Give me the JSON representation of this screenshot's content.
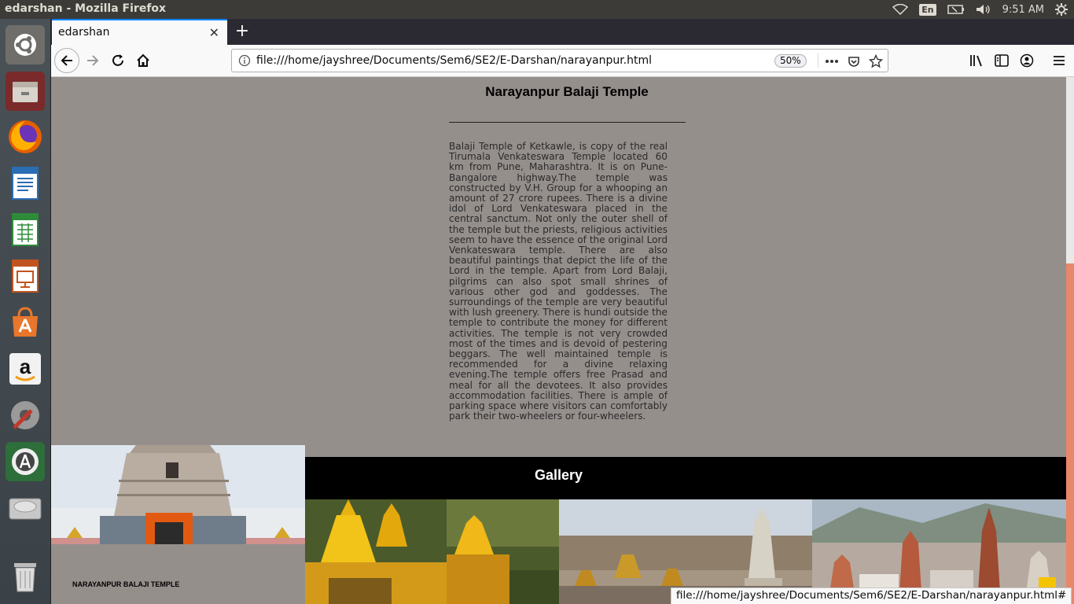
{
  "system": {
    "window_title": "edarshan - Mozilla Firefox",
    "input_lang": "En",
    "clock": "9:51 AM"
  },
  "launcher": {
    "items": [
      "ubuntu-dash-icon",
      "files-icon",
      "firefox-icon",
      "writer-icon",
      "calc-icon",
      "impress-icon",
      "software-center-icon",
      "amazon-icon",
      "system-settings-icon",
      "software-updater-icon",
      "disk-icon",
      "trash-icon"
    ]
  },
  "browser": {
    "tab_title": "edarshan",
    "url": "file:///home/jayshree/Documents/Sem6/SE2/E-Darshan/narayanpur.html",
    "zoom": "50%",
    "status_url": "file:///home/jayshree/Documents/Sem6/SE2/E-Darshan/narayanpur.html#"
  },
  "page": {
    "title": "Narayanpur Balaji Temple",
    "body": "Balaji Temple of Ketkawle, is copy of the real Tirumala Venkateswara Temple located 60 km from Pune, Maharashtra. It is on Pune-Bangalore highway.The temple was constructed by V.H. Group for a whooping an amount of 27 crore rupees. There is a divine idol of Lord Venkateswara placed in the central sanctum. Not only the outer shell of the temple but the priests, religious activities seem to have the essence of the original Lord Venkateswara temple. There are also beautiful paintings that depict the life of the Lord in the temple. Apart from Lord Balaji, pilgrims can also spot small shrines of various other god and goddesses. The surroundings of the temple are very beautiful with lush greenery. There is hundi outside the temple to contribute the money for different activities. The temple is not very crowded most of the times and is devoid of pestering beggars. The well maintained temple is recommended for a divine relaxing evening.The temple offers free Prasad and meal for all the devotees. It also provides accommodation facilities. There is ample of parking space where visitors can comfortably park their two-wheelers or four-wheelers.",
    "left_caption": "NARAYANPUR BALAJI TEMPLE",
    "gallery_title": "Gallery"
  }
}
